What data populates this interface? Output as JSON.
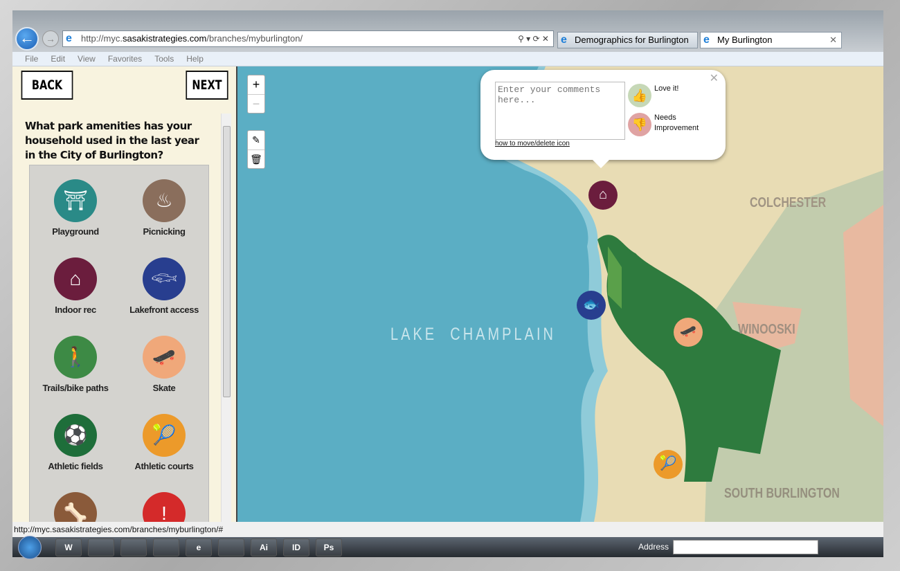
{
  "browser": {
    "url_prefix": "http://myc.",
    "url_domain": "sasakistrategies.com",
    "url_path": "/branches/myburlington/",
    "tabs": [
      {
        "label": "Demographics for Burlington -..."
      },
      {
        "label": "My Burlington"
      }
    ],
    "menu": [
      "File",
      "Edit",
      "View",
      "Favorites",
      "Tools",
      "Help"
    ],
    "status": "http://myc.sasakistrategies.com/branches/myburlington/#"
  },
  "panel": {
    "back": "BACK",
    "next": "NEXT",
    "question": "What park amenities has your household used in the last year in the City of Burlington?",
    "amenities": [
      {
        "label": "Playground",
        "icon": "swing-icon",
        "color": "#2a8a87"
      },
      {
        "label": "Picnicking",
        "icon": "grill-icon",
        "color": "#8a6e5c"
      },
      {
        "label": "Indoor rec",
        "icon": "indoor-rec-icon",
        "color": "#6b1d3d"
      },
      {
        "label": "Lakefront access",
        "icon": "fish-icon",
        "color": "#283e8f"
      },
      {
        "label": "Trails/bike paths",
        "icon": "hiker-icon",
        "color": "#3d8a45"
      },
      {
        "label": "Skate",
        "icon": "skateboard-icon",
        "color": "#f0a87a"
      },
      {
        "label": "Athletic fields",
        "icon": "soccer-ball-icon",
        "color": "#1e6e3a"
      },
      {
        "label": "Athletic courts",
        "icon": "tennis-racket-icon",
        "color": "#ec9a2a"
      },
      {
        "label": "",
        "icon": "bone-icon",
        "color": "#8a5a3a"
      },
      {
        "label": "",
        "icon": "alert-icon",
        "color": "#d42a2a"
      }
    ]
  },
  "map": {
    "zoom_in": "+",
    "zoom_out": "−",
    "labels": {
      "lake": "LAKE  CHAMPLAIN",
      "colchester": "COLCHESTER",
      "winooski": "WINOOSKI",
      "south_burlington": "SOUTH BURLINGTON"
    },
    "popup": {
      "placeholder": "Enter your comments here...",
      "love": "Love it!",
      "needs": "Needs Improvement",
      "howto": "how to move/delete icon"
    }
  },
  "taskbar": {
    "address_label": "Address",
    "apps": [
      "W",
      "",
      "",
      "",
      "e",
      "",
      "Ai",
      "ID",
      "Ps"
    ]
  }
}
